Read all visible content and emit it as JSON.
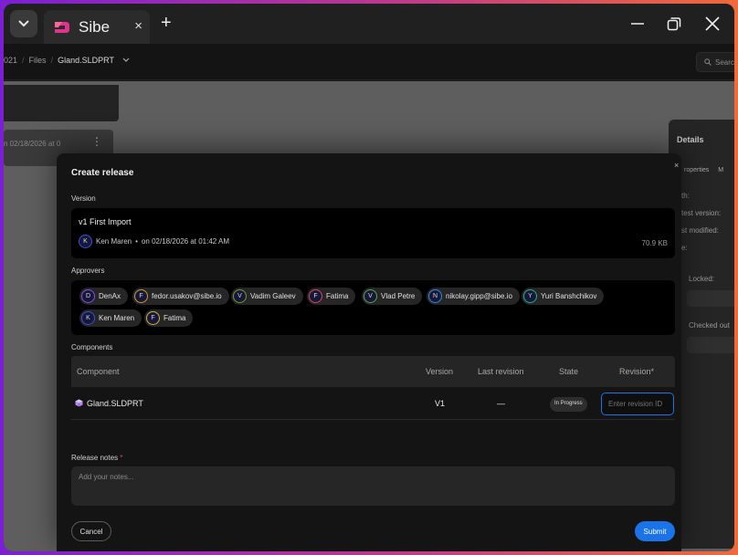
{
  "browser": {
    "tab_title": "Sibe",
    "tab_close": "×",
    "new_tab": "+",
    "colors": {
      "frame_gradient": [
        "#7b1fd6",
        "#f06a3a"
      ],
      "logo": "#e0348c"
    }
  },
  "breadcrumb": {
    "items": [
      "021",
      "Files",
      "Gland.SLDPRT"
    ],
    "search_placeholder": "Search"
  },
  "background": {
    "card_text": "n 02/18/2026 at 0",
    "details": {
      "title": "Details",
      "tabs": [
        "roperties",
        "M"
      ],
      "rows": [
        "th:",
        "test version:",
        "st modified:",
        "e:",
        "Locked:",
        "Checked out"
      ]
    }
  },
  "modal": {
    "title": "Create release",
    "close": "×",
    "version_label": "Version",
    "version": {
      "number": "v1",
      "name": "First Import",
      "author_initial": "K",
      "author": "Ken Maren",
      "dot": "•",
      "date": "on 02/18/2026 at 01:42 AM",
      "size": "70.9 KB"
    },
    "approvers_label": "Approvers",
    "approvers": [
      {
        "initial": "D",
        "name": "DenAx",
        "color": "#8a4fd6"
      },
      {
        "initial": "F",
        "name": "fedor.usakov@sibe.io",
        "color": "#d69a2a"
      },
      {
        "initial": "V",
        "name": "Vadim Galeev",
        "color": "#7a9a2a"
      },
      {
        "initial": "F",
        "name": "Fatima",
        "color": "#d64a5a"
      },
      {
        "initial": "V",
        "name": "Vlad Petre",
        "color": "#5aa84a"
      },
      {
        "initial": "N",
        "name": "nikolay.gipp@sibe.io",
        "color": "#3a8ad6"
      },
      {
        "initial": "Y",
        "name": "Yuri Banshchikov",
        "color": "#2ab08a"
      },
      {
        "initial": "K",
        "name": "Ken Maren",
        "color": "#3a52d6"
      },
      {
        "initial": "F",
        "name": "Fatima",
        "color": "#d6b03a"
      }
    ],
    "components_label": "Components",
    "table": {
      "headers": [
        "Component",
        "Version",
        "Last revision",
        "State",
        "Revision*"
      ],
      "row": {
        "component": "Gland.SLDPRT",
        "version": "V1",
        "last_revision": "—",
        "state": "In Progress",
        "revision_placeholder": "Enter revision ID"
      }
    },
    "notes_label": "Release notes",
    "notes_required": "*",
    "notes_placeholder": "Add your notes...",
    "cancel": "Cancel",
    "submit": "Submit",
    "colors": {
      "accent": "#1a73e8",
      "required": "#e04848"
    }
  }
}
